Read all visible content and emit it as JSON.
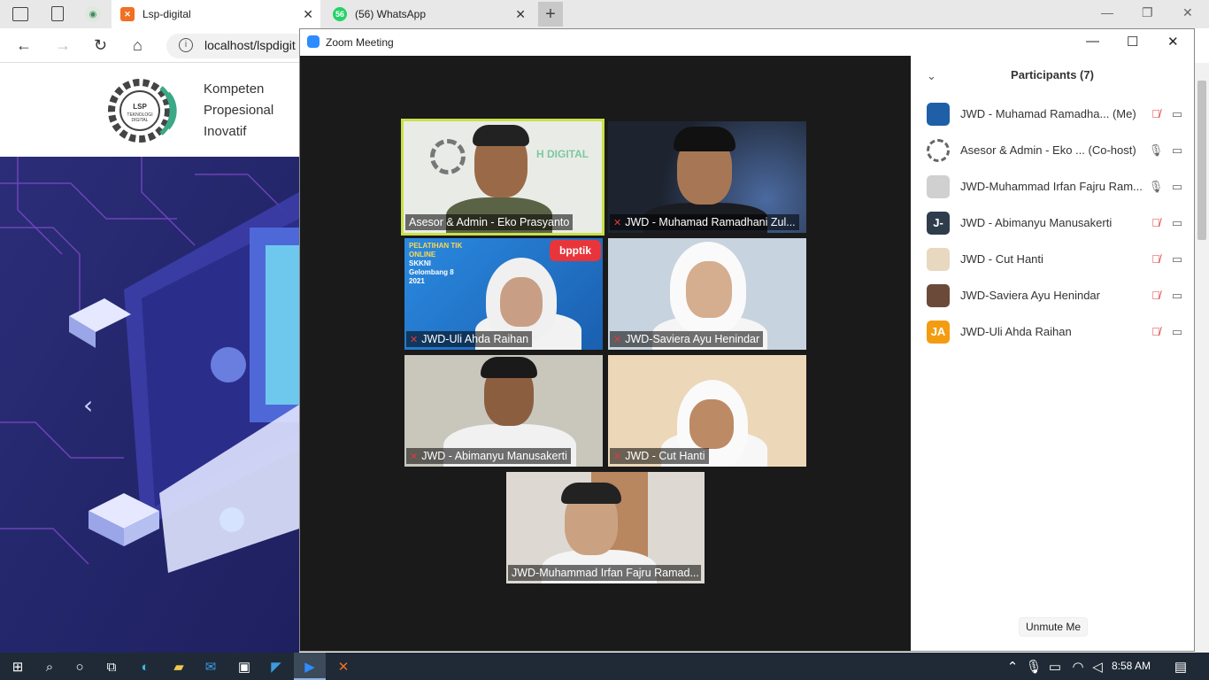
{
  "browser": {
    "tabs": [
      {
        "title": "Lsp-digital",
        "active": true
      },
      {
        "title": "(56) WhatsApp",
        "badge": "56",
        "active": false
      }
    ],
    "url": "localhost/lspdigit"
  },
  "site": {
    "tagline": [
      "Kompeten",
      "Propesional",
      "Inovatif"
    ],
    "logo_text": "LSP TEKNOLOGI DIGITAL"
  },
  "zoom": {
    "window_title": "Zoom Meeting",
    "tiles": [
      {
        "name": "Asesor & Admin - Eko Prasyanto",
        "muted": false,
        "speaking": true
      },
      {
        "name": "JWD - Muhamad Ramadhani Zul...",
        "muted": true
      },
      {
        "name": "JWD-Uli Ahda Raihan",
        "muted": true
      },
      {
        "name": "JWD-Saviera Ayu Henindar",
        "muted": true
      },
      {
        "name": "JWD - Abimanyu Manusakerti",
        "muted": true
      },
      {
        "name": "JWD - Cut Hanti",
        "muted": true
      },
      {
        "name": "JWD-Muhammad Irfan Fajru Ramad...",
        "muted": false
      }
    ],
    "banner": {
      "line1": "PELATIHAN TIK",
      "line2": "ONLINE",
      "line3": "SKKNI",
      "line4": "Gelombang 8",
      "line5": "2021",
      "brand": "bpptik"
    },
    "participants": {
      "title": "Participants (7)",
      "list": [
        {
          "name": "JWD - Muhamad Ramadha...",
          "tag": "(Me)",
          "mic_muted": true,
          "avatar_color": "#1f5fa8",
          "initials": ""
        },
        {
          "name": "Asesor & Admin - Eko ...",
          "tag": "(Co-host)",
          "mic_muted": false,
          "avatar_color": "#ffffff",
          "initials": ""
        },
        {
          "name": "JWD-Muhammad Irfan Fajru Ram...",
          "tag": "",
          "mic_muted": false,
          "avatar_color": "#d0d0d0",
          "initials": ""
        },
        {
          "name": "JWD - Abimanyu Manusakerti",
          "tag": "",
          "mic_muted": true,
          "avatar_color": "#2f3c4c",
          "initials": "J-"
        },
        {
          "name": "JWD - Cut Hanti",
          "tag": "",
          "mic_muted": true,
          "avatar_color": "#e8d8c0",
          "initials": ""
        },
        {
          "name": "JWD-Saviera Ayu Henindar",
          "tag": "",
          "mic_muted": true,
          "avatar_color": "#6b4a3a",
          "initials": ""
        },
        {
          "name": "JWD-Uli Ahda Raihan",
          "tag": "",
          "mic_muted": true,
          "avatar_color": "#f39c12",
          "initials": "JA"
        }
      ],
      "unmute_label": "Unmute Me"
    }
  },
  "taskbar": {
    "time": "8:58 AM"
  }
}
